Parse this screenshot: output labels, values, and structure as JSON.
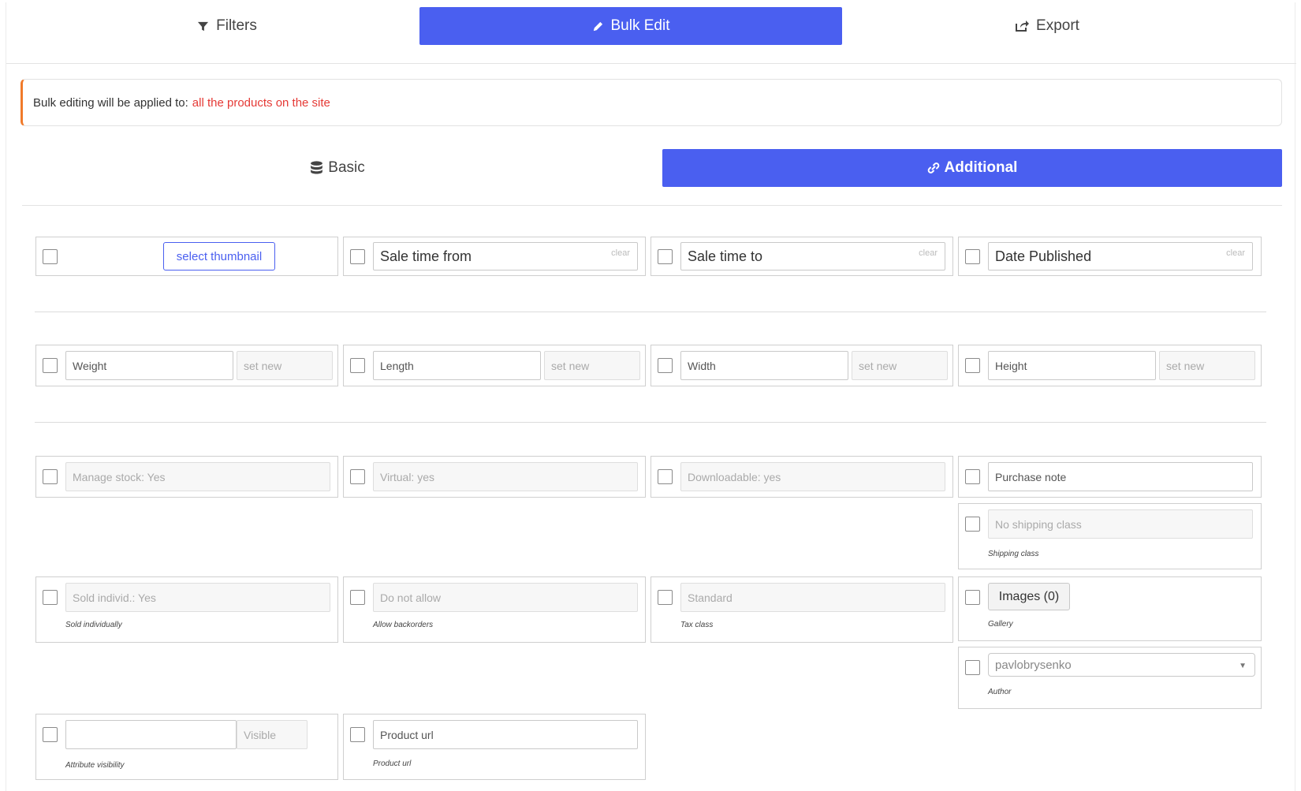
{
  "top_tabs": {
    "filters": "Filters",
    "bulk_edit": "Bulk Edit",
    "export": "Export"
  },
  "notice": {
    "prefix": "Bulk editing will be applied to:",
    "highlight": "all the products on the site",
    "highlight_color": "#e53935",
    "accent_color": "#f07a2a"
  },
  "sub_tabs": {
    "basic": "Basic",
    "additional": "Additional"
  },
  "accent": "#4a5ff0",
  "row1": {
    "thumbnail_button": "select thumbnail",
    "sale_from": "Sale time from",
    "sale_to": "Sale time to",
    "date_published": "Date Published",
    "clear": "clear"
  },
  "row2": {
    "weight": "Weight",
    "length": "Length",
    "width": "Width",
    "height": "Height",
    "set_new": "set new"
  },
  "row3": {
    "manage_stock": "Manage stock: Yes",
    "virtual": "Virtual: yes",
    "downloadable": "Downloadable: yes",
    "purchase_note": "Purchase note",
    "shipping_class_value": "No shipping class",
    "shipping_class_note": "Shipping class"
  },
  "row4": {
    "sold_individually_value": "Sold individ.: Yes",
    "sold_individually_note": "Sold individually",
    "backorders_value": "Do not allow",
    "backorders_note": "Allow backorders",
    "tax_class_value": "Standard",
    "tax_class_note": "Tax class",
    "images_button": "Images (0)",
    "gallery_note": "Gallery",
    "author_value": "pavlobrysenko",
    "author_note": "Author"
  },
  "row5": {
    "attribute_value": "",
    "visible": "Visible",
    "attribute_note": "Attribute visibility",
    "product_url": "Product url",
    "product_url_note": "Product url"
  }
}
